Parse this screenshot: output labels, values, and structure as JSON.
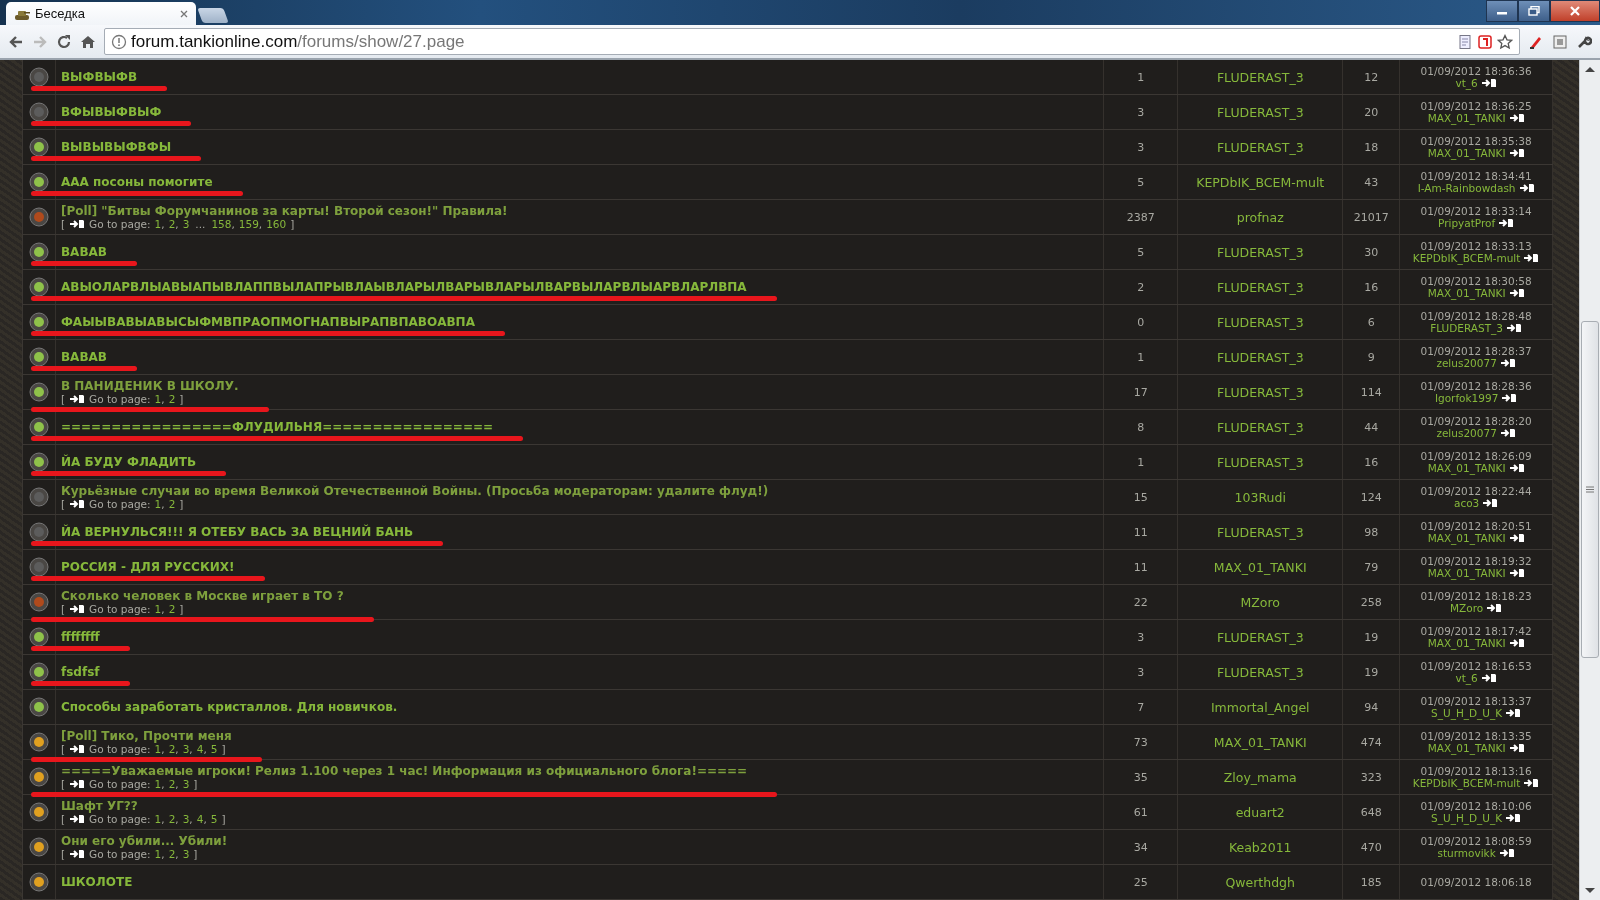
{
  "window": {
    "tab_title": "Беседка",
    "url_host": "forum.tankionline.com",
    "url_path": "/forums/show/27.page"
  },
  "rows": [
    {
      "title": "ВЫФВЫФВ",
      "color": "#5c5c5c",
      "marked": true,
      "replies": "1",
      "author": "FLUDERAST_3",
      "views": "12",
      "date": "01/09/2012 18:36:36",
      "last": "vt_6"
    },
    {
      "title": "ВФЫВЫФВЫФ",
      "color": "#5c5c5c",
      "marked": true,
      "replies": "3",
      "author": "FLUDERAST_3",
      "views": "20",
      "date": "01/09/2012 18:36:25",
      "last": "MAX_01_TANKI"
    },
    {
      "title": "ВЫВЫВЫФВФЫ",
      "color": "#8fc24a",
      "marked": true,
      "replies": "3",
      "author": "FLUDERAST_3",
      "views": "18",
      "date": "01/09/2012 18:35:38",
      "last": "MAX_01_TANKI"
    },
    {
      "title": "ААА посоны помогите",
      "color": "#8fc24a",
      "marked": true,
      "replies": "5",
      "author": "KEPDbIK_BCEM-mult",
      "views": "43",
      "date": "01/09/2012 18:34:41",
      "last": "I-Am-Rainbowdash"
    },
    {
      "title": "[Poll] \"Битвы Форумчанинов за карты! Второй сезон!\" Правила!",
      "color": "#b04a1c",
      "marked": false,
      "pager": {
        "open": "[",
        "label": "Go to page:",
        "items": [
          {
            "kind": "link",
            "text": "1",
            "sep": ","
          },
          {
            "kind": "link",
            "text": "2",
            "sep": ","
          },
          {
            "kind": "link",
            "text": "3"
          },
          {
            "kind": "gap",
            "text": "..."
          },
          {
            "kind": "link",
            "text": "158",
            "sep": ","
          },
          {
            "kind": "link",
            "text": "159",
            "sep": ","
          },
          {
            "kind": "link",
            "text": "160"
          }
        ],
        "close": "]"
      },
      "replies": "2387",
      "author": "profnaz",
      "views": "21017",
      "date": "01/09/2012 18:33:14",
      "last": "PripyatProf"
    },
    {
      "title": "ВАВАВ",
      "color": "#8fc24a",
      "marked": true,
      "replies": "5",
      "author": "FLUDERAST_3",
      "views": "30",
      "date": "01/09/2012 18:33:13",
      "last": "KEPDbIK_BCEM-mult"
    },
    {
      "title": "АВЫОЛАРВЛЫАВЫАПЫВЛАППВЫЛАПРЫВЛАЫВЛАРЫЛВАРЫВЛАРЫЛВАРВЫЛАРВЛЫАРВЛАРЛВПА",
      "color": "#8fc24a",
      "marked": true,
      "replies": "2",
      "author": "FLUDERAST_3",
      "views": "16",
      "date": "01/09/2012 18:30:58",
      "last": "MAX_01_TANKI"
    },
    {
      "title": "ФАЫЫВАВЫАВЫСЫФМВПРАОПМОГНАПВЫРАПВПАВОАВПА",
      "color": "#8fc24a",
      "marked": true,
      "replies": "0",
      "author": "FLUDERAST_3",
      "views": "6",
      "date": "01/09/2012 18:28:48",
      "last": "FLUDERAST_3"
    },
    {
      "title": "ВАВАВ",
      "color": "#8fc24a",
      "marked": true,
      "replies": "1",
      "author": "FLUDERAST_3",
      "views": "9",
      "date": "01/09/2012 18:28:37",
      "last": "zelus20077"
    },
    {
      "title": "В ПАНИДЕНИК В ШКОЛУ.",
      "color": "#8fc24a",
      "marked": true,
      "pager": {
        "open": "[",
        "label": "Go to page:",
        "items": [
          {
            "kind": "link",
            "text": "1",
            "sep": ","
          },
          {
            "kind": "link",
            "text": "2"
          }
        ],
        "close": "]"
      },
      "replies": "17",
      "author": "FLUDERAST_3",
      "views": "114",
      "date": "01/09/2012 18:28:36",
      "last": "Igorfok1997"
    },
    {
      "title": "=================ФЛУДИЛЬНЯ=================",
      "color": "#8fc24a",
      "marked": true,
      "replies": "8",
      "author": "FLUDERAST_3",
      "views": "44",
      "date": "01/09/2012 18:28:20",
      "last": "zelus20077"
    },
    {
      "title": "ЙА БУДУ ФЛАДИТЬ",
      "color": "#8fc24a",
      "marked": true,
      "replies": "1",
      "author": "FLUDERAST_3",
      "views": "16",
      "date": "01/09/2012 18:26:09",
      "last": "MAX_01_TANKI"
    },
    {
      "title": "Курьёзные случаи во время Великой Отечественной Войны. (Просьба модераторам: удалите флуд!)",
      "color": "#5c5c5c",
      "marked": false,
      "pager": {
        "open": "[",
        "label": "Go to page:",
        "items": [
          {
            "kind": "link",
            "text": "1",
            "sep": ","
          },
          {
            "kind": "link",
            "text": "2"
          }
        ],
        "close": "]"
      },
      "replies": "15",
      "author": "103Rudi",
      "views": "124",
      "date": "01/09/2012 18:22:44",
      "last": "aco3"
    },
    {
      "title": "ЙА ВЕРНУЛЬСЯ!!! Я ОТЕБУ ВАСЬ ЗА ВЕЦНИЙ БАНЬ",
      "color": "#5c5c5c",
      "marked": true,
      "replies": "11",
      "author": "FLUDERAST_3",
      "views": "98",
      "date": "01/09/2012 18:20:51",
      "last": "MAX_01_TANKI"
    },
    {
      "title": "РОССИЯ - ДЛЯ РУССКИХ!",
      "color": "#5c5c5c",
      "marked": true,
      "replies": "11",
      "author": "MAX_01_TANKI",
      "views": "79",
      "date": "01/09/2012 18:19:32",
      "last": "MAX_01_TANKI"
    },
    {
      "title": "Сколько человек в Москве играет в ТО ?",
      "color": "#b04a1c",
      "marked": true,
      "pager": {
        "open": "[",
        "label": "Go to page:",
        "items": [
          {
            "kind": "link",
            "text": "1",
            "sep": ","
          },
          {
            "kind": "link",
            "text": "2"
          }
        ],
        "close": "]"
      },
      "replies": "22",
      "author": "MZoro",
      "views": "258",
      "date": "01/09/2012 18:18:23",
      "last": "MZoro"
    },
    {
      "title": "ffffffff",
      "color": "#8fc24a",
      "marked": true,
      "replies": "3",
      "author": "FLUDERAST_3",
      "views": "19",
      "date": "01/09/2012 18:17:42",
      "last": "MAX_01_TANKI"
    },
    {
      "title": "fsdfsf",
      "color": "#8fc24a",
      "marked": true,
      "replies": "3",
      "author": "FLUDERAST_3",
      "views": "19",
      "date": "01/09/2012 18:16:53",
      "last": "vt_6"
    },
    {
      "title": "Способы заработать кристаллов. Для новичков.",
      "color": "#8fc24a",
      "marked": false,
      "replies": "7",
      "author": "Immortal_Angel",
      "views": "94",
      "date": "01/09/2012 18:13:37",
      "last": "S_U_H_D_U_K"
    },
    {
      "title": "[Poll] Тико, Прочти меня",
      "color": "#e0a020",
      "marked": true,
      "pager": {
        "open": "[",
        "label": "Go to page:",
        "items": [
          {
            "kind": "link",
            "text": "1",
            "sep": ","
          },
          {
            "kind": "link",
            "text": "2",
            "sep": ","
          },
          {
            "kind": "link",
            "text": "3",
            "sep": ","
          },
          {
            "kind": "link",
            "text": "4",
            "sep": ","
          },
          {
            "kind": "link",
            "text": "5"
          }
        ],
        "close": "]"
      },
      "replies": "73",
      "author": "MAX_01_TANKI",
      "views": "474",
      "date": "01/09/2012 18:13:35",
      "last": "MAX_01_TANKI"
    },
    {
      "title": "=====Уважаемые игроки! Релиз 1.100 через 1 час! Информация из официального блога!=====",
      "color": "#e0a020",
      "marked": true,
      "pager": {
        "open": "[",
        "label": "Go to page:",
        "items": [
          {
            "kind": "link",
            "text": "1",
            "sep": ","
          },
          {
            "kind": "link",
            "text": "2",
            "sep": ","
          },
          {
            "kind": "link",
            "text": "3"
          }
        ],
        "close": "]"
      },
      "replies": "35",
      "author": "Zloy_mama",
      "views": "323",
      "date": "01/09/2012 18:13:16",
      "last": "KEPDbIK_BCEM-mult"
    },
    {
      "title": "Шафт УГ??",
      "color": "#e0a020",
      "marked": false,
      "pager": {
        "open": "[",
        "label": "Go to page:",
        "items": [
          {
            "kind": "link",
            "text": "1",
            "sep": ","
          },
          {
            "kind": "link",
            "text": "2",
            "sep": ","
          },
          {
            "kind": "link",
            "text": "3",
            "sep": ","
          },
          {
            "kind": "link",
            "text": "4",
            "sep": ","
          },
          {
            "kind": "link",
            "text": "5"
          }
        ],
        "close": "]"
      },
      "replies": "61",
      "author": "eduart2",
      "views": "648",
      "date": "01/09/2012 18:10:06",
      "last": "S_U_H_D_U_K"
    },
    {
      "title": "Они его убили... Убили!",
      "color": "#e0a020",
      "marked": false,
      "pager": {
        "open": "[",
        "label": "Go to page:",
        "items": [
          {
            "kind": "link",
            "text": "1",
            "sep": ","
          },
          {
            "kind": "link",
            "text": "2",
            "sep": ","
          },
          {
            "kind": "link",
            "text": "3"
          }
        ],
        "close": "]"
      },
      "replies": "34",
      "author": "Keab2011",
      "views": "470",
      "date": "01/09/2012 18:08:59",
      "last": "sturmovikk"
    },
    {
      "title": "ШКОЛОТЕ",
      "color": "#e0a020",
      "marked": false,
      "replies": "25",
      "author": "Qwerthdgh",
      "views": "185",
      "date": "01/09/2012 18:06:18"
    }
  ]
}
